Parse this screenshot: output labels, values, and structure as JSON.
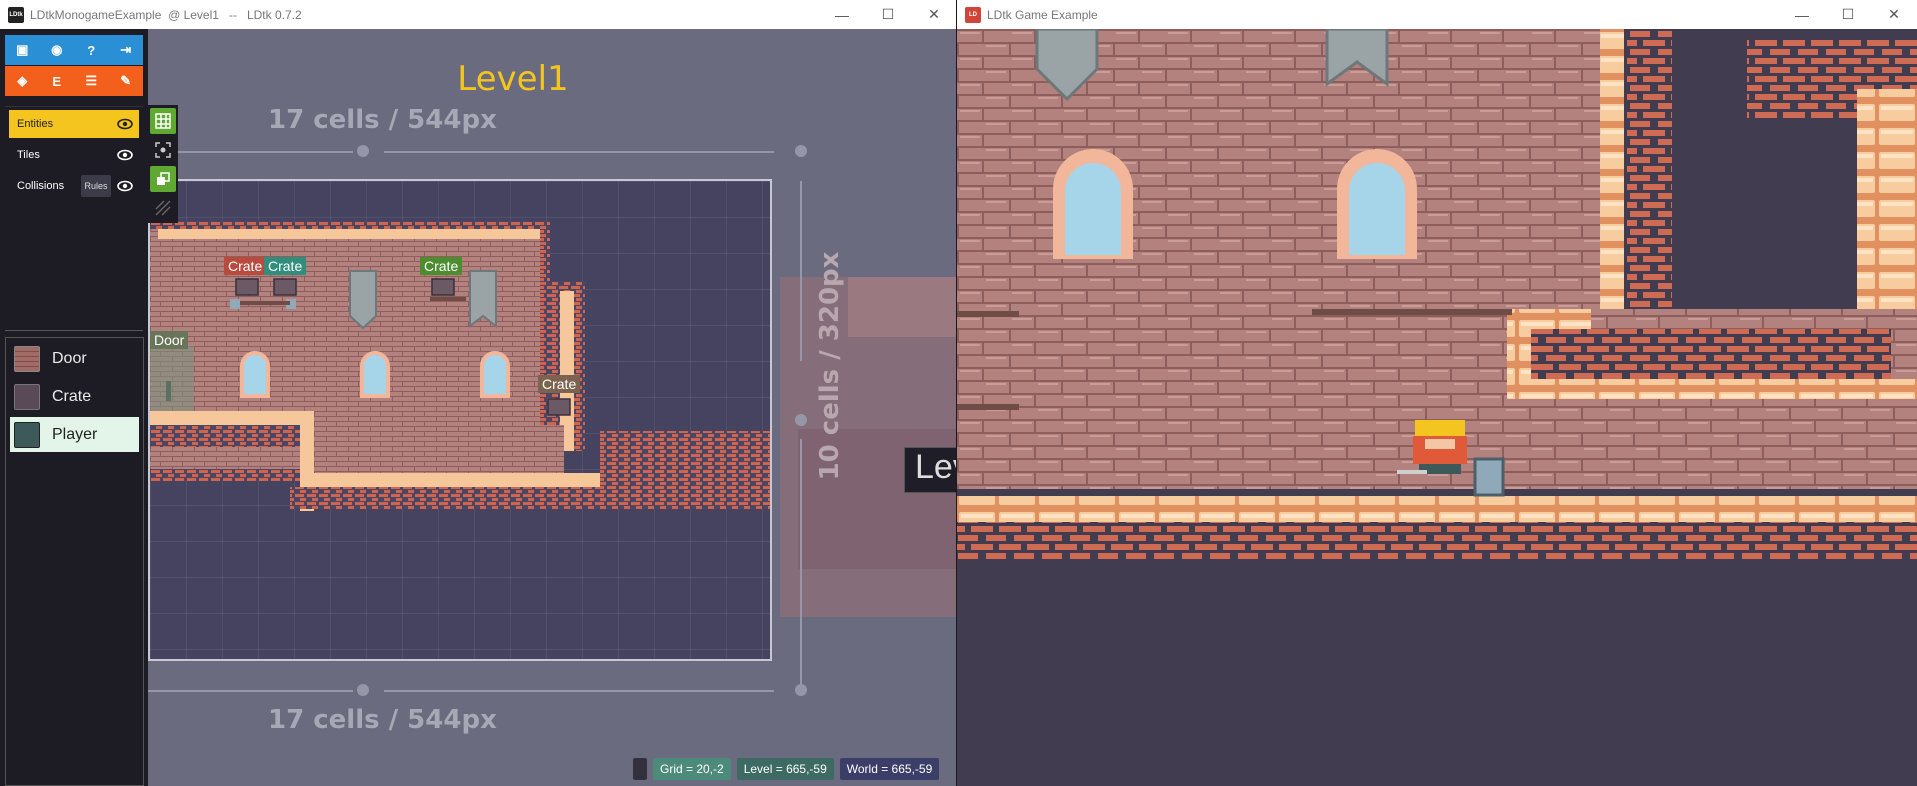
{
  "ldtk_window": {
    "title": "LDtkMonogameExample  @ Level1   --   LDtk 0.7.2",
    "logo_text": "LDtk",
    "controls": {
      "minimize": "—",
      "maximize": "☐",
      "close": "✕"
    }
  },
  "toolbar": {
    "top_row": [
      "▣",
      "◉",
      "?",
      "⇥"
    ],
    "bottom_row": [
      "◈",
      "E",
      "☰",
      "✎"
    ]
  },
  "layers": [
    {
      "name": "Entities",
      "active": true
    },
    {
      "name": "Tiles",
      "active": false
    },
    {
      "name": "Collisions",
      "active": false,
      "rules_label": "Rules"
    }
  ],
  "entities": [
    {
      "name": "Door",
      "active": false
    },
    {
      "name": "Crate",
      "active": false
    },
    {
      "name": "Player",
      "active": true
    }
  ],
  "level": {
    "name": "Level1",
    "width_label_top": "17 cells / 544px",
    "width_label_bottom": "17 cells / 544px",
    "height_label": "10 cells / 320px",
    "neighbor_label": "Lev"
  },
  "entity_tags": [
    {
      "label": "Crate",
      "color": "#c0392b"
    },
    {
      "label": "Crate",
      "color": "#2e8b77"
    },
    {
      "label": "Crate",
      "color": "#4a8c2e"
    },
    {
      "label": "Door",
      "color": "#6b7a5a"
    },
    {
      "label": "Crate",
      "color": "#7a5f4a"
    }
  ],
  "status": {
    "grid": "Grid = 20,-2",
    "level": "Level = 665,-59",
    "world": "World = 665,-59"
  },
  "game_window": {
    "title": "LDtk Game Example",
    "logo_text": "LD",
    "controls": {
      "minimize": "—",
      "maximize": "☐",
      "close": "✕"
    }
  },
  "colors": {
    "accent_yellow": "#f4c51f",
    "toolbar_blue": "#2a8fd4",
    "toolbar_orange": "#f2601c",
    "brick": "#b07f7d",
    "brick_dark": "#8b5a57",
    "floor_cream": "#f5c79a"
  }
}
